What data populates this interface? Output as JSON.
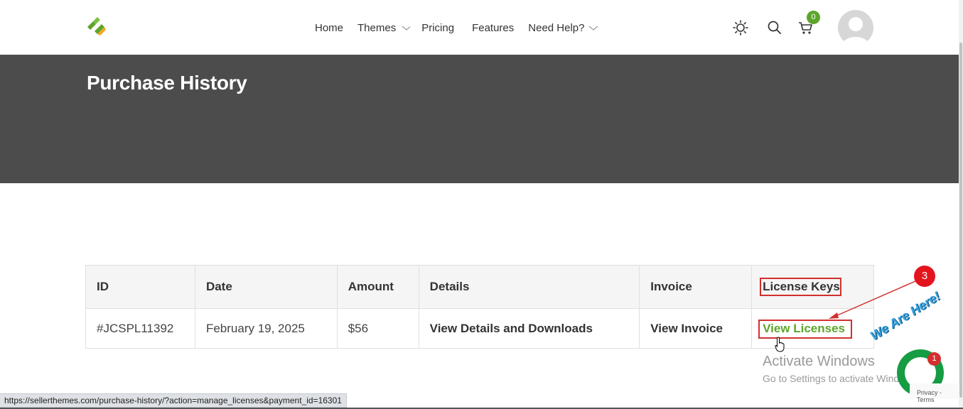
{
  "nav": {
    "items": [
      {
        "label": "Home",
        "dropdown": false
      },
      {
        "label": "Themes",
        "dropdown": true
      },
      {
        "label": "Pricing",
        "dropdown": false
      },
      {
        "label": "Features",
        "dropdown": false
      },
      {
        "label": "Need Help?",
        "dropdown": true
      }
    ]
  },
  "header": {
    "cart_count": "0",
    "icons": [
      "sun-icon",
      "search-icon",
      "cart-icon",
      "avatar"
    ]
  },
  "hero": {
    "title": "Purchase History"
  },
  "table": {
    "headers": [
      "ID",
      "Date",
      "Amount",
      "Details",
      "Invoice",
      "License Keys"
    ],
    "rows": [
      {
        "id": "#JCSPL11392",
        "date": "February 19, 2025",
        "amount": "$56",
        "details": "View Details and Downloads",
        "invoice": "View Invoice",
        "licenses": "View Licenses"
      }
    ]
  },
  "annotation": {
    "step": "3"
  },
  "watermark": {
    "line1": "Activate Windows",
    "line2": "Go to Settings to activate Windows."
  },
  "chat": {
    "label": "We Are Here!",
    "badge": "1"
  },
  "recaptcha": {
    "text": "Privacy - Terms"
  },
  "status_bar": {
    "url": "https://sellerthemes.com/purchase-history/?action=manage_licenses&payment_id=16301"
  },
  "colors": {
    "accent": "#5da52a",
    "hero_bg": "#4c4c4c",
    "annotation": "#e3141d",
    "chat_green": "#169c43"
  }
}
